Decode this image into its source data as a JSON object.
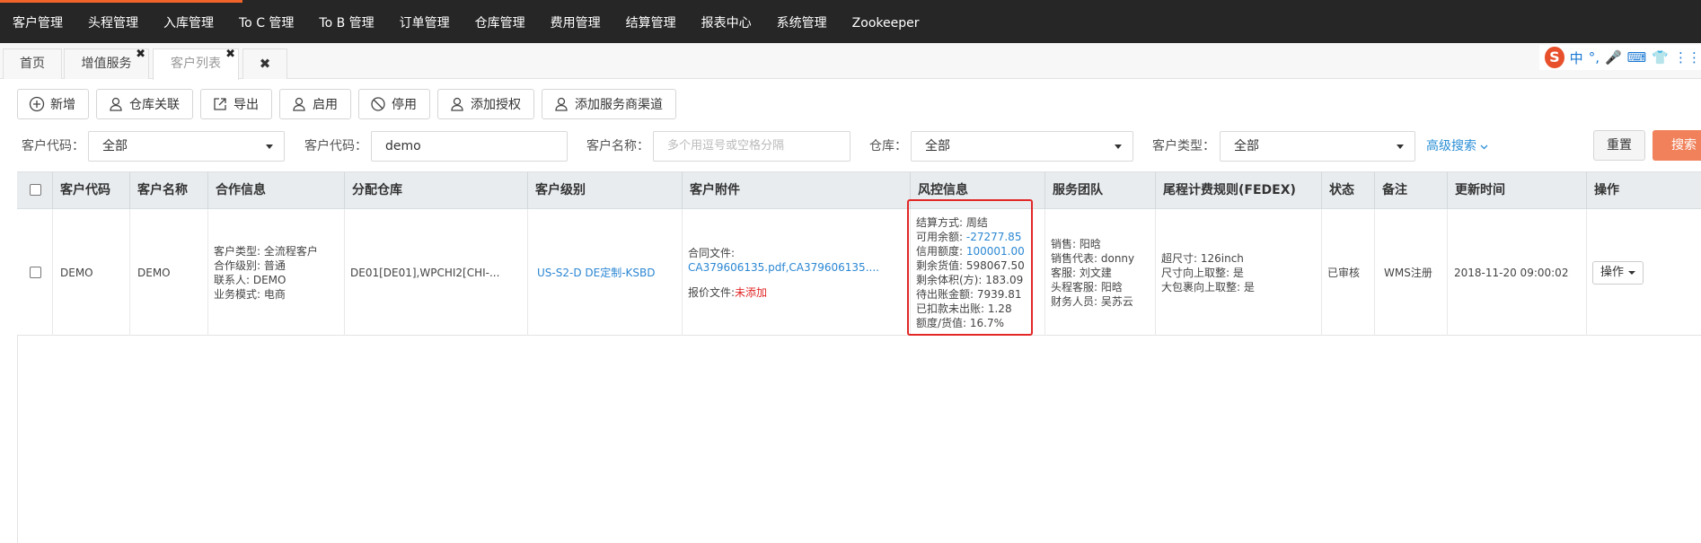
{
  "nav": [
    "客户管理",
    "头程管理",
    "入库管理",
    "To C 管理",
    "To B 管理",
    "订单管理",
    "仓库管理",
    "费用管理",
    "结算管理",
    "报表中心",
    "系统管理",
    "Zookeeper"
  ],
  "tabs": {
    "home": "首页",
    "value_added": "增值服务",
    "customer_list": "客户列表",
    "close": "✖"
  },
  "ime": {
    "logo": "S",
    "items": [
      "中",
      "°,",
      "🎤",
      "⌨",
      "👕",
      "⋮⋮"
    ]
  },
  "toolbar": {
    "add": "新增",
    "warehouse_link": "仓库关联",
    "export": "导出",
    "enable": "启用",
    "disable": "停用",
    "add_auth": "添加授权",
    "add_channel": "添加服务商渠道"
  },
  "filters": {
    "code_label_1": "客户代码：",
    "code_value_1": "全部",
    "code_label_2": "客户代码：",
    "code_value_2": "demo",
    "name_label": "客户名称：",
    "name_placeholder": "多个用逗号或空格分隔",
    "warehouse_label": "仓库：",
    "warehouse_value": "全部",
    "type_label": "客户类型：",
    "type_value": "全部",
    "advanced": "高级搜索",
    "reset": "重置",
    "search": "搜索"
  },
  "table": {
    "headers": {
      "code": "客户代码",
      "name": "客户名称",
      "contract": "合作信息",
      "warehouse": "分配仓库",
      "level": "客户级别",
      "attachment": "客户附件",
      "risk": "风控信息",
      "team": "服务团队",
      "tail_rule": "尾程计费规则(FEDEX)",
      "status": "状态",
      "remark": "备注",
      "updated": "更新时间",
      "ops": "操作"
    },
    "row": {
      "code": "DEMO",
      "name": "DEMO",
      "contract": [
        "客户类型: 全流程客户",
        "合作级别: 普通",
        "联系人: DEMO",
        "业务模式: 电商"
      ],
      "warehouse": "DE01[DE01],WPCHI2[CHI-...",
      "level": "US-S2-D DE定制-KSBD",
      "attachment": {
        "contract_label": "合同文件:",
        "contract_files": "CA379606135.pdf,CA379606135....",
        "quote_label": "报价文件:",
        "quote_status": "未添加"
      },
      "risk": {
        "settle_label": "结算方式: ",
        "settle_value": "周结",
        "avail_label": "可用余额: ",
        "avail_value": "-27277.85",
        "credit_label": "信用额度: ",
        "credit_value": "100001.00",
        "goods_value": "剩余货值: 598067.50",
        "volume": "剩余体积(方): 183.09",
        "pending": "待出账金额: 7939.81",
        "deducted": "已扣款未出账: 1.28",
        "ratio": "额度/货值: 16.7%"
      },
      "team": [
        "销售: 阳晗",
        "销售代表: donny",
        "客服: 刘文建",
        "头程客服: 阳晗",
        "财务人员: 吴苏云"
      ],
      "tail_rule": [
        "超尺寸: 126inch",
        "尺寸向上取整: 是",
        "大包裹向上取整: 是"
      ],
      "status": "已审核",
      "remark": "WMS注册",
      "updated": "2018-11-20 09:00:02",
      "op_button": "操作"
    }
  },
  "colors": {
    "accent": "#f0642a",
    "link": "#2b87d3",
    "highlight": "#e32727"
  }
}
